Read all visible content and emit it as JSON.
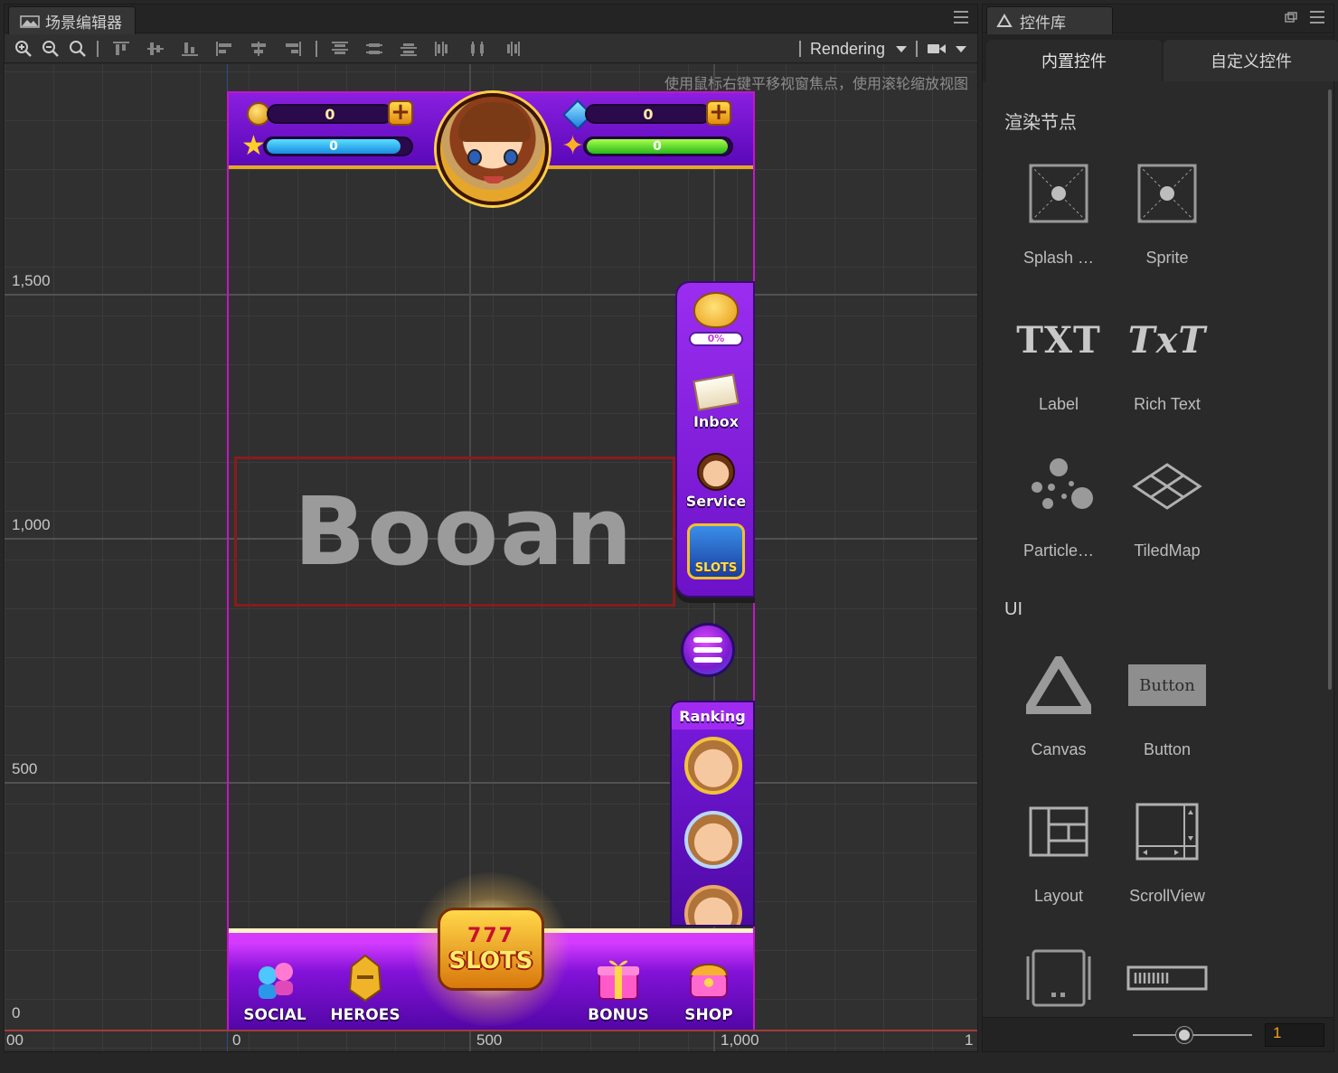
{
  "scene_panel": {
    "tab_title": "场景编辑器",
    "icons": {
      "tab": "scene-icon",
      "menu": "hamburger-icon"
    },
    "toolbar": {
      "zoom_in": "zoom-in-icon",
      "zoom_out": "zoom-out-icon",
      "zoom_fit": "zoom-fit-icon",
      "rendering_label": "Rendering",
      "camera": "camera-icon"
    },
    "hint": "使用鼠标右键平移视窗焦点，使用滚轮缩放视图",
    "ruler": {
      "y": [
        "1,500",
        "1,000",
        "500",
        "0"
      ],
      "x": [
        "00",
        "0",
        "500",
        "1,000",
        "1"
      ]
    }
  },
  "game": {
    "coins_value": "0",
    "xp_value": "0",
    "gems_value": "0",
    "energy_value": "0",
    "side_menu": {
      "piggy_percent": "0%",
      "inbox_label": "Inbox",
      "service_label": "Service",
      "slots_label": "SLOTS"
    },
    "ranking_title": "Ranking",
    "bottom_nav": {
      "social": "SOCIAL",
      "heroes": "HEROES",
      "slots_word": "SLOTS",
      "slots_reels": "777",
      "bonus": "BONUS",
      "shop": "SHOP"
    },
    "watermark": "Booan",
    "colors": {
      "frame": "#c316c8",
      "purple": "#8a1fe0",
      "gold": "#e7a82a"
    }
  },
  "library_panel": {
    "tab_title": "控件库",
    "subtabs": [
      "内置控件",
      "自定义控件"
    ],
    "sections": {
      "render": "渲染节点",
      "ui": "UI"
    },
    "render_widgets": [
      "Splash …",
      "Sprite",
      "Label",
      "Rich Text",
      "Particle…",
      "TiledMap"
    ],
    "ui_widgets": [
      "Canvas",
      "Button",
      "Layout",
      "ScrollView"
    ],
    "label_icon_text": "TXT",
    "richtext_icon_text": "TxT",
    "button_icon_text": "Button",
    "zoom_value": "1"
  }
}
